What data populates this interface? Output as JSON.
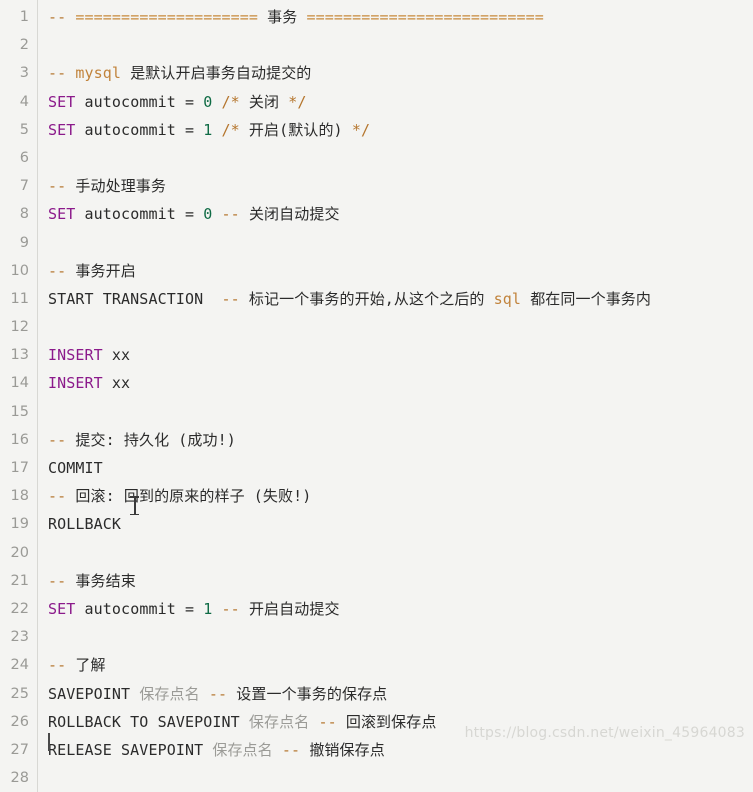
{
  "editor": {
    "language": "sql",
    "background_color": "#f4f4f2",
    "gutter_color": "#9a9a96",
    "total_lines": 28,
    "first_visible_line": 1,
    "mouse_cursor": "text-ibeam",
    "text_caret_line": 28
  },
  "colors": {
    "keyword": "#8b1a8b",
    "plain": "#2b2b2b",
    "number": "#0f6b45",
    "comment_mark": "#b5762e",
    "comment_body": "#d9b68c",
    "comment_latin": "#c1833c",
    "placeholder_ident": "#9b9b97",
    "rule": "#c78a3c"
  },
  "line_numbers": [
    "1",
    "2",
    "3",
    "4",
    "5",
    "6",
    "7",
    "8",
    "9",
    "10",
    "11",
    "12",
    "13",
    "14",
    "15",
    "16",
    "17",
    "18",
    "19",
    "20",
    "21",
    "22",
    "23",
    "24",
    "25",
    "26",
    "27",
    "28"
  ],
  "lines": [
    {
      "n": "1",
      "tokens": [
        {
          "c": "t-cmt-dash",
          "t": "-- "
        },
        {
          "c": "t-rule",
          "t": "===================="
        },
        {
          "c": "t-cmt",
          "t": " 事务 "
        },
        {
          "c": "t-rule",
          "t": "=========================="
        }
      ]
    },
    {
      "n": "2",
      "tokens": []
    },
    {
      "n": "3",
      "tokens": [
        {
          "c": "t-cmt-dash",
          "t": "-- "
        },
        {
          "c": "t-cmt-lat",
          "t": "mysql"
        },
        {
          "c": "t-cmt",
          "t": " 是默认开启事务自动提交的"
        }
      ]
    },
    {
      "n": "4",
      "tokens": [
        {
          "c": "t-kw",
          "t": "SET"
        },
        {
          "c": "t-plain",
          "t": " autocommit "
        },
        {
          "c": "t-op",
          "t": "= "
        },
        {
          "c": "t-num",
          "t": "0"
        },
        {
          "c": "t-plain",
          "t": " "
        },
        {
          "c": "t-cmt-dash",
          "t": "/*"
        },
        {
          "c": "t-cmt",
          "t": " 关闭 "
        },
        {
          "c": "t-cmt-dash",
          "t": "*/"
        }
      ]
    },
    {
      "n": "5",
      "tokens": [
        {
          "c": "t-kw",
          "t": "SET"
        },
        {
          "c": "t-plain",
          "t": " autocommit "
        },
        {
          "c": "t-op",
          "t": "= "
        },
        {
          "c": "t-num",
          "t": "1"
        },
        {
          "c": "t-plain",
          "t": " "
        },
        {
          "c": "t-cmt-dash",
          "t": "/*"
        },
        {
          "c": "t-cmt",
          "t": " 开启(默认的) "
        },
        {
          "c": "t-cmt-dash",
          "t": "*/"
        }
      ]
    },
    {
      "n": "6",
      "tokens": []
    },
    {
      "n": "7",
      "tokens": [
        {
          "c": "t-cmt-dash",
          "t": "-- "
        },
        {
          "c": "t-cmt",
          "t": "手动处理事务"
        }
      ]
    },
    {
      "n": "8",
      "tokens": [
        {
          "c": "t-kw",
          "t": "SET"
        },
        {
          "c": "t-plain",
          "t": " autocommit "
        },
        {
          "c": "t-op",
          "t": "= "
        },
        {
          "c": "t-num",
          "t": "0"
        },
        {
          "c": "t-plain",
          "t": " "
        },
        {
          "c": "t-cmt-dash",
          "t": "-- "
        },
        {
          "c": "t-cmt",
          "t": "关闭自动提交"
        }
      ]
    },
    {
      "n": "9",
      "tokens": []
    },
    {
      "n": "10",
      "tokens": [
        {
          "c": "t-cmt-dash",
          "t": "-- "
        },
        {
          "c": "t-cmt",
          "t": "事务开启"
        }
      ]
    },
    {
      "n": "11",
      "tokens": [
        {
          "c": "t-plain",
          "t": "START TRANSACTION  "
        },
        {
          "c": "t-cmt-dash",
          "t": "-- "
        },
        {
          "c": "t-cmt",
          "t": "标记一个事务的开始,从这个之后的 "
        },
        {
          "c": "t-cmt-lat",
          "t": "sql"
        },
        {
          "c": "t-cmt",
          "t": " 都在同一个事务内"
        }
      ]
    },
    {
      "n": "12",
      "tokens": []
    },
    {
      "n": "13",
      "tokens": [
        {
          "c": "t-kw",
          "t": "INSERT"
        },
        {
          "c": "t-plain",
          "t": " xx"
        }
      ]
    },
    {
      "n": "14",
      "tokens": [
        {
          "c": "t-kw",
          "t": "INSERT"
        },
        {
          "c": "t-plain",
          "t": " xx"
        }
      ]
    },
    {
      "n": "15",
      "tokens": []
    },
    {
      "n": "16",
      "tokens": [
        {
          "c": "t-cmt-dash",
          "t": "-- "
        },
        {
          "c": "t-cmt",
          "t": "提交: 持久化 (成功!)"
        }
      ]
    },
    {
      "n": "17",
      "tokens": [
        {
          "c": "t-plain",
          "t": "COMMIT"
        }
      ]
    },
    {
      "n": "18",
      "tokens": [
        {
          "c": "t-cmt-dash",
          "t": "-- "
        },
        {
          "c": "t-cmt",
          "t": "回滚: 回到的原来的样子 (失败!)"
        }
      ]
    },
    {
      "n": "19",
      "tokens": [
        {
          "c": "t-plain",
          "t": "ROLLBACK"
        }
      ]
    },
    {
      "n": "20",
      "tokens": []
    },
    {
      "n": "21",
      "tokens": [
        {
          "c": "t-cmt-dash",
          "t": "-- "
        },
        {
          "c": "t-cmt",
          "t": "事务结束"
        }
      ]
    },
    {
      "n": "22",
      "tokens": [
        {
          "c": "t-kw",
          "t": "SET"
        },
        {
          "c": "t-plain",
          "t": " autocommit "
        },
        {
          "c": "t-op",
          "t": "= "
        },
        {
          "c": "t-num",
          "t": "1"
        },
        {
          "c": "t-plain",
          "t": " "
        },
        {
          "c": "t-cmt-dash",
          "t": "-- "
        },
        {
          "c": "t-cmt",
          "t": "开启自动提交"
        }
      ]
    },
    {
      "n": "23",
      "tokens": []
    },
    {
      "n": "24",
      "tokens": [
        {
          "c": "t-cmt-dash",
          "t": "-- "
        },
        {
          "c": "t-cmt",
          "t": "了解"
        }
      ]
    },
    {
      "n": "25",
      "tokens": [
        {
          "c": "t-plain",
          "t": "SAVEPOINT "
        },
        {
          "c": "t-gray",
          "t": "保存点名"
        },
        {
          "c": "t-plain",
          "t": " "
        },
        {
          "c": "t-cmt-dash",
          "t": "-- "
        },
        {
          "c": "t-cmt",
          "t": "设置一个事务的保存点"
        }
      ]
    },
    {
      "n": "26",
      "tokens": [
        {
          "c": "t-plain",
          "t": "ROLLBACK TO SAVEPOINT "
        },
        {
          "c": "t-gray",
          "t": "保存点名"
        },
        {
          "c": "t-plain",
          "t": " "
        },
        {
          "c": "t-cmt-dash",
          "t": "-- "
        },
        {
          "c": "t-cmt",
          "t": "回滚到保存点"
        }
      ]
    },
    {
      "n": "27",
      "tokens": [
        {
          "c": "t-plain",
          "t": "RELEASE SAVEPOINT "
        },
        {
          "c": "t-gray",
          "t": "保存点名"
        },
        {
          "c": "t-plain",
          "t": " "
        },
        {
          "c": "t-cmt-dash",
          "t": "-- "
        },
        {
          "c": "t-cmt",
          "t": "撤销保存点"
        }
      ]
    },
    {
      "n": "28",
      "tokens": []
    }
  ],
  "watermark": {
    "text": "https://blog.csdn.net/weixin_45964083"
  }
}
